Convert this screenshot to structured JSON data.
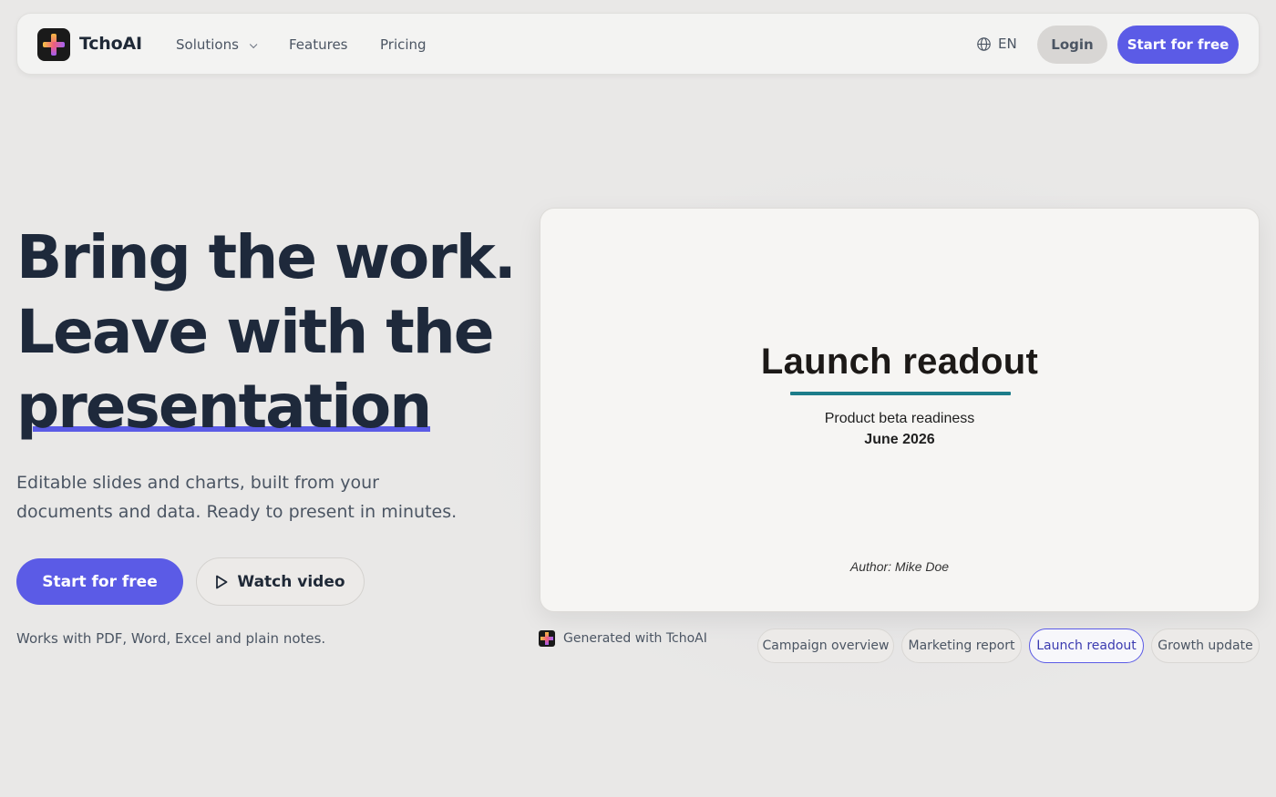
{
  "nav": {
    "brand": "TchoAI",
    "links": [
      "Solutions",
      "Features",
      "Pricing"
    ],
    "language": "EN",
    "login_label": "Login",
    "start_label": "Start for free"
  },
  "hero": {
    "title_line1": "Bring the work.",
    "title_line2": "Leave with the",
    "title_line3": "presentation",
    "subtitle": "Editable slides and charts, built from your documents and data. Ready to present in minutes.",
    "start_label": "Start for free",
    "watch_label": "Watch video",
    "works_with": "Works with PDF, Word, Excel and plain notes."
  },
  "preview": {
    "slide": {
      "title": "Launch readout",
      "subtitle": "Product beta readiness",
      "date": "June 2026",
      "author": "Author: Mike Doe"
    },
    "generated_label": "Generated with TchoAI",
    "templates": [
      {
        "label": "Campaign overview",
        "active": false
      },
      {
        "label": "Marketing report",
        "active": false
      },
      {
        "label": "Launch readout",
        "active": true
      },
      {
        "label": "Growth update",
        "active": false
      }
    ]
  },
  "colors": {
    "accent": "#5b5be6",
    "slide_rule": "#1d7d8a",
    "background": "#e9e8e7"
  },
  "icons": {
    "language": "globe-icon",
    "watch": "play-icon",
    "solutions_menu": "chevron-down-icon"
  }
}
